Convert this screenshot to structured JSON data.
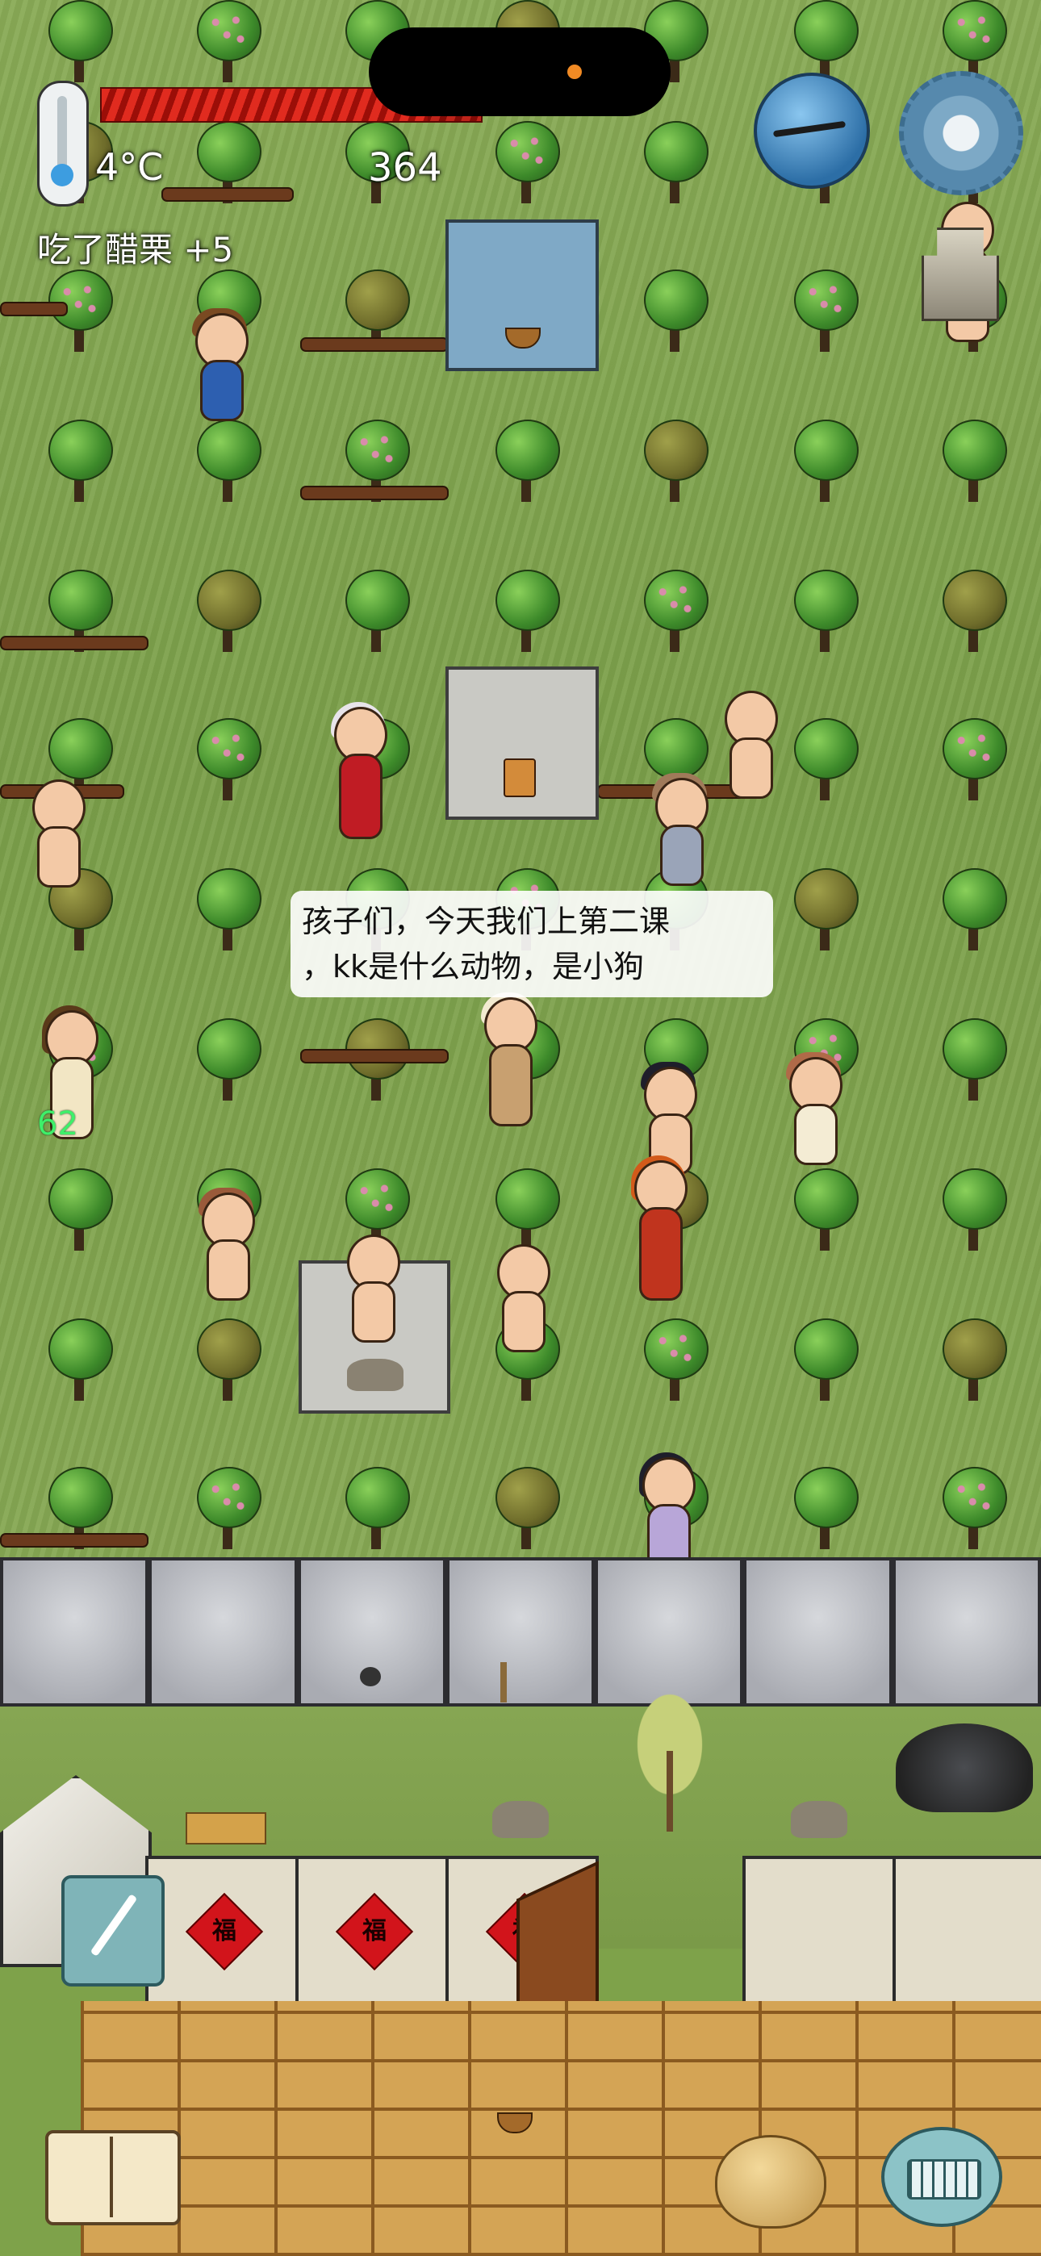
{
  "hud": {
    "temperature": "4°C",
    "age": "364",
    "food_fraction": 0.86,
    "message": "吃了醋栗 +5"
  },
  "chat": {
    "speech_line1": "孩子们，今天我们上第二课",
    "speech_line2": "，kk是什么动物，是小狗"
  },
  "overlay": {
    "player_number": "62"
  },
  "wall": {
    "sign_glyph": "福"
  },
  "colors": {
    "grass": "#7ea24a",
    "food_bar": "#e02b1f",
    "speech_bg": "#ffffff",
    "player_number": "#3ef06a"
  },
  "icons": {
    "thermometer": "thermometer-icon",
    "compass": "compass-icon",
    "settings": "gear-icon",
    "tool": "tool-slot-icon",
    "pencil": "pencil-icon",
    "book": "book-icon",
    "emote": "potato-face-icon",
    "keyboard": "keyboard-icon"
  }
}
